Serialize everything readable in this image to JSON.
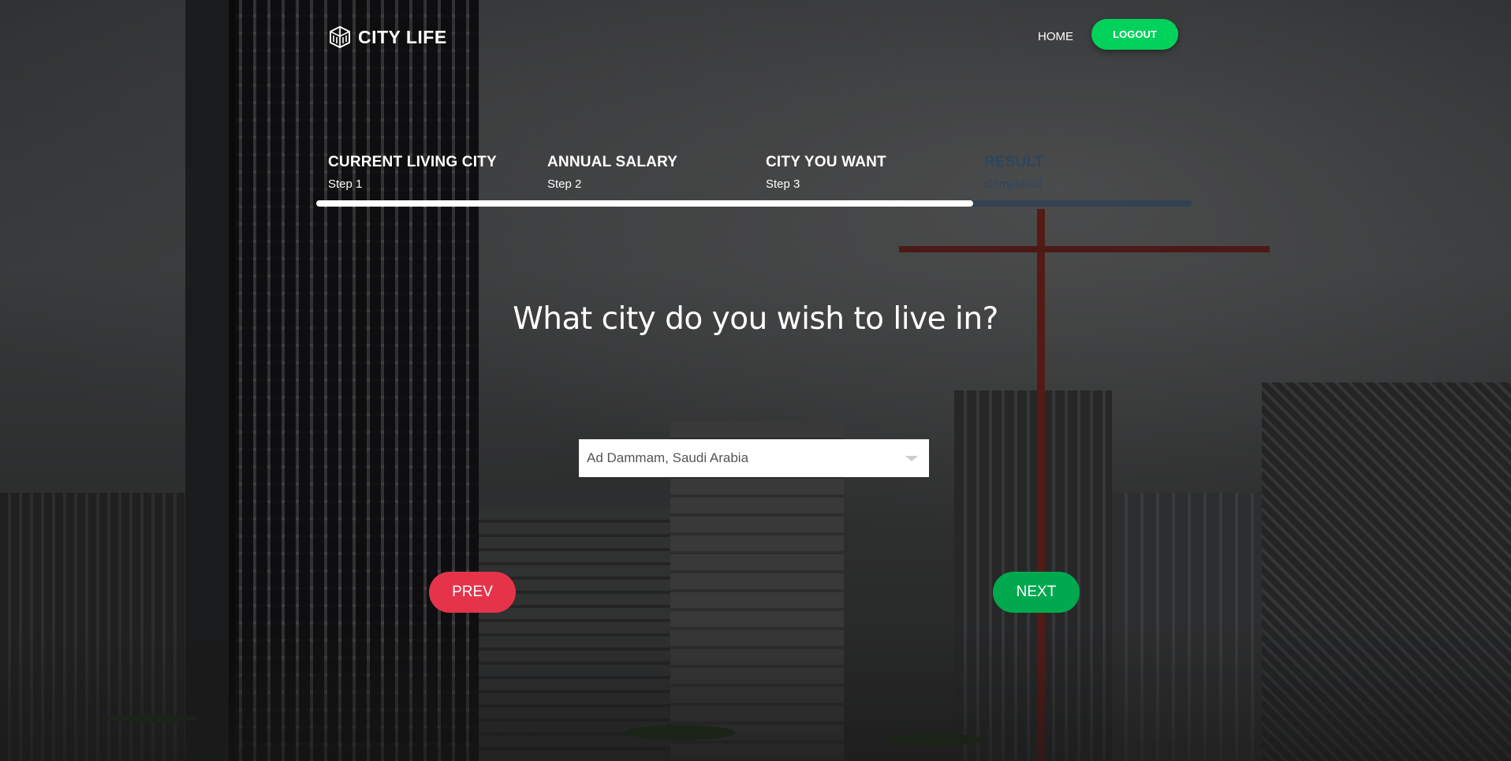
{
  "header": {
    "brand": "CITY LIFE",
    "logo_icon": "buildings-icon",
    "nav_home": "HOME",
    "logout_label": "LOGOUT"
  },
  "steps": [
    {
      "title": "CURRENT LIVING CITY",
      "subtitle": "Step 1",
      "state": "done"
    },
    {
      "title": "ANNUAL SALARY",
      "subtitle": "Step 2",
      "state": "done"
    },
    {
      "title": "CITY YOU WANT",
      "subtitle": "Step 3",
      "state": "active"
    },
    {
      "title": "RESULT",
      "subtitle": "Completed",
      "state": "inactive"
    }
  ],
  "progress": {
    "fraction": 0.75
  },
  "question": "What city do you wish to live in?",
  "city_select": {
    "value": "Ad Dammam, Saudi Arabia"
  },
  "buttons": {
    "prev": "PREV",
    "next": "NEXT"
  },
  "colors": {
    "logout": "#00d25b",
    "prev": "#e5344a",
    "next": "#00a94e",
    "inactive_step": "#234566"
  }
}
